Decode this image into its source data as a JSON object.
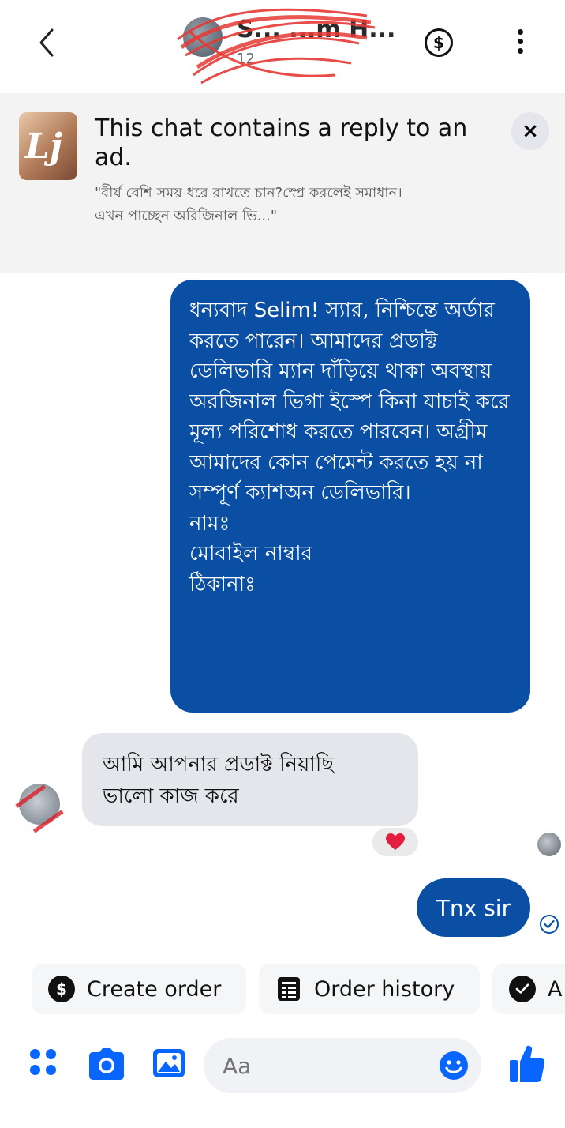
{
  "header": {
    "contact_name": "S... ...m H...",
    "contact_sub": "12",
    "back_icon": "chevron-left-icon",
    "payments_icon": "dollar-circle-icon",
    "menu_icon": "more-vertical-icon"
  },
  "ad_banner": {
    "title": "This chat contains a reply to an ad.",
    "quote": "\"বীর্য বেশি সময় ধরে রাখতে চান?স্প্রে করলেই সমাধান।\nএখন পাচ্ছেন অরিজিনাল ভি...\"",
    "close_label": "×"
  },
  "messages": {
    "outgoing_1": "ধন্যবাদ Selim! স্যার, নিশ্চিন্তে অর্ডার করতে পারেন। আমাদের প্রডাক্ট ডেলিভারি ম্যান দাঁড়িয়ে থাকা অবস্থায় অরজিনাল ভিগা ইস্পে কিনা যাচাই করে মূল্য পরিশোধ করতে পারবেন। অগ্রীম আমাদের কোন পেমেন্ট করতে হয় না সম্পূর্ণ ক্যাশঅন ডেলিভারি।\nনামঃ\nমোবাইল নাম্বার\nঠিকানাঃ",
    "incoming_1": "আমি আপনার প্রডাক্ট নিয়াছি\nভালো কাজ করে",
    "reaction": "heart-icon",
    "outgoing_2": "Tnx sir"
  },
  "quick_actions": {
    "create_order": "Create order",
    "order_history": "Order history",
    "third": "A"
  },
  "composer": {
    "placeholder": "Aa"
  },
  "colors": {
    "bubble_out": "#0a4fa3",
    "bubble_in": "#e4e6eb",
    "accent": "#0866ff"
  }
}
